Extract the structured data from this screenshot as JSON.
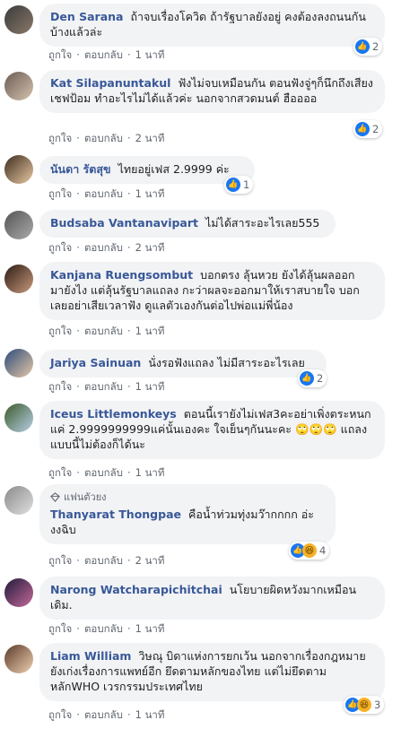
{
  "actions": {
    "like": "ถูกใจ",
    "reply": "ตอบกลับ",
    "dot": "·"
  },
  "comments": [
    {
      "name": "Den Sarana",
      "text": "ถ้าจบเรื่องโควิด ถ้ารัฐบาลยังอยู่ คงต้องลงถนนกันบ้างแล้วล่ะ",
      "time": "1 นาที",
      "reaction_count": "2",
      "reactions": [
        "like"
      ]
    },
    {
      "name": "Kat Silapanuntakul",
      "text": "ฟังไม่จบเหมือนกัน ตอนฟังจู่ๆก็นึกถึงเสียงเชฟป้อม ทำอะไรไม่ได้แล้วค่ะ นอกจากสวดมนต์ ฮืออออ",
      "time": "2 นาที",
      "reaction_count": "2",
      "reactions": [
        "like"
      ]
    },
    {
      "name": "นันดา รัตสุข",
      "text": "ไทยอยู่เฟส 2.9999 ค่ะ",
      "time": "1 นาที",
      "reaction_count": "1",
      "reactions": [
        "like"
      ]
    },
    {
      "name": "Budsaba Vantanavipart",
      "text": "ไม่ได้สาระอะไรเลย555",
      "time": "2 นาที",
      "reaction_count": "",
      "reactions": []
    },
    {
      "name": "Kanjana Ruengsombut",
      "text": "บอกตรง ลุ้นหวย ยังได้ลุ้นผลออกมายังไง แต่ลุ้นรัฐบาลแถลง กะว่าผลจะออกมาให้เราสบายใจ บอกเลยอย่าเสียเวลาฟัง ดูแลตัวเองกันต่อไปพ่อแม่พี่น้อง",
      "time": "1 นาที",
      "reaction_count": "",
      "reactions": []
    },
    {
      "name": "Jariya Sainuan",
      "text": "นั่งรอฟังแถลง ไม่มีสาระอะไรเลย",
      "time": "1 นาที",
      "reaction_count": "2",
      "reactions": [
        "like"
      ]
    },
    {
      "name": "Iceus Littlemonkeys",
      "text": "ตอนนี้เรายังไม่เฟส3คะอย่าเพิ่งตระหนกแค่ 2.9999999999แค่นั้นเองคะ ใจเย็นๆกันนะคะ 🙄🙄🙄 แถลงแบบนี้ไม่ต้องก็ได้นะ",
      "time": "1 นาที",
      "reaction_count": "",
      "reactions": []
    },
    {
      "badge": "แฟนตัวยง",
      "name": "Thanyarat Thongpae",
      "text": "คือน้ำท่วมทุ่งมว๊ากกกก อ่ะ งงฉิบ",
      "time": "2 นาที",
      "reaction_count": "4",
      "reactions": [
        "like",
        "haha"
      ]
    },
    {
      "name": "Narong Watcharapichitchai",
      "text": "นโยบายผิดหวังมากเหมือนเดิม.",
      "time": "1 นาที",
      "reaction_count": "",
      "reactions": []
    },
    {
      "name": "Liam William",
      "text": "วิษณุ บิดาแห่งการยกเว้น นอกจากเรื่องกฎหมาย ยังเก่งเรื่องการแพทย์อีก ยึดตามหลักของไทย แต่ไม่ยึดตามหลักWHO เวรกรรมประเทศไทย",
      "time": "1 นาที",
      "reaction_count": "3",
      "reactions": [
        "like",
        "haha"
      ]
    }
  ],
  "colors": {
    "name": "#385898",
    "bubble": "#f2f3f5",
    "like": "#1877f2",
    "haha": "#f7b125",
    "meta": "#606770"
  }
}
